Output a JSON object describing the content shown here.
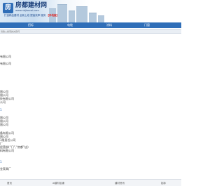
{
  "header": {
    "site_name": "房都建材网",
    "site_url": "www.nbjiancai.com",
    "tagline_text": "打造精品建材 全新上线 提高效率 服务",
    "tagline_mark": "【手机版】",
    "logo_letter": "房",
    "logo_icon": "house-logo-icon"
  },
  "nav": {
    "items": [
      {
        "label": "招标"
      },
      {
        "label": "电缆"
      },
      {
        "label": "涂料"
      },
      {
        "label": "门窗"
      }
    ]
  },
  "search": {
    "placeholder": "请输入搜索的关键词"
  },
  "content": {
    "blocks": [
      {
        "rows": [
          "有限公司",
          "有限公司"
        ]
      },
      {
        "rows": [
          "限公司",
          "限公司",
          "技有限公司",
          "公司"
        ]
      },
      {
        "rows": [
          "1",
          "限公司",
          "限公司",
          "限公司"
        ]
      },
      {
        "rows": [
          "备有限公司",
          "限公司",
          "1限责任公司",
          "厂",
          "经营部(“门”,“房都”店)",
          "料有限公司"
        ]
      },
      {
        "rows": [
          "1",
          "金家具厂"
        ]
      }
    ]
  },
  "footer": {
    "items": [
      {
        "label": "首页"
      },
      {
        "label": "w建材店铺"
      },
      {
        "label": "建材资讯"
      },
      {
        "label": "招标"
      }
    ]
  },
  "colors": {
    "nav_bg": "#2f6eb8",
    "tagline_accent": "#e0201c",
    "link": "#2f6eb8"
  }
}
